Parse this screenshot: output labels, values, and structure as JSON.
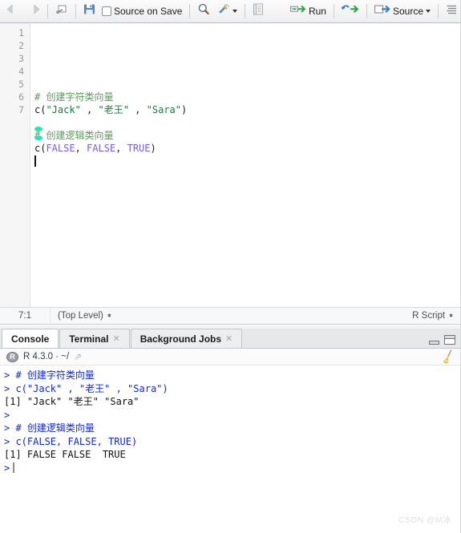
{
  "toolbar": {
    "back_icon": "arrow-left-icon",
    "forward_icon": "arrow-right-icon",
    "popout_icon": "show-in-new-window-icon",
    "save_icon": "save-icon",
    "source_on_save_label": "Source on Save",
    "find_icon": "magnifier-icon",
    "wand_icon": "magic-wand-icon",
    "compile_report_icon": "compile-report-icon",
    "run_label": "Run",
    "run_icon": "run-icon",
    "rerun_icon": "rerun-icon",
    "source_label": "Source",
    "source_icon": "source-icon",
    "outline_icon": "document-outline-icon"
  },
  "editor": {
    "line_numbers": [
      "1",
      "2",
      "3",
      "4",
      "5",
      "6",
      "7"
    ],
    "lines": [
      {
        "tokens": []
      },
      {
        "tokens": [
          {
            "t": "# 创建字符类向量",
            "k": "cmt"
          }
        ]
      },
      {
        "tokens": [
          {
            "t": "c(",
            "k": "pln"
          },
          {
            "t": "\"Jack\"",
            "k": "str"
          },
          {
            "t": " , ",
            "k": "pln"
          },
          {
            "t": "\"老王\"",
            "k": "str"
          },
          {
            "t": " , ",
            "k": "pln"
          },
          {
            "t": "\"Sara\"",
            "k": "str"
          },
          {
            "t": ")",
            "k": "pln"
          }
        ]
      },
      {
        "tokens": []
      },
      {
        "tokens": [
          {
            "t": "# 创建逻辑类向量",
            "k": "cmt"
          }
        ]
      },
      {
        "tokens": [
          {
            "t": "c(",
            "k": "pln"
          },
          {
            "t": "FALSE",
            "k": "kw"
          },
          {
            "t": ", ",
            "k": "pln"
          },
          {
            "t": "FALSE",
            "k": "kw"
          },
          {
            "t": ", ",
            "k": "pln"
          },
          {
            "t": "TRUE",
            "k": "kw"
          },
          {
            "t": ")",
            "k": "pln"
          }
        ]
      },
      {
        "tokens": []
      }
    ]
  },
  "status": {
    "cursor_position": "7:1",
    "scope": "(Top Level)",
    "file_type": "R Script"
  },
  "console_tabs": [
    {
      "label": "Console",
      "closable": false,
      "active": true
    },
    {
      "label": "Terminal",
      "closable": true,
      "active": false
    },
    {
      "label": "Background Jobs",
      "closable": true,
      "active": false
    }
  ],
  "console_tab_controls": {
    "minimize_icon": "minimize-icon",
    "maximize_icon": "maximize-icon"
  },
  "console_header": {
    "r_logo": "R",
    "version_path": "R 4.3.0  ·  ~/",
    "open_dir_icon": "open-directory-icon",
    "clear_icon": "broom-clear-console-icon"
  },
  "console_output": [
    {
      "segments": [
        {
          "t": "> # 创建字符类向量",
          "k": "in"
        }
      ]
    },
    {
      "segments": [
        {
          "t": "> c(\"Jack\" , \"老王\" , \"Sara\")",
          "k": "in"
        }
      ]
    },
    {
      "segments": [
        {
          "t": "[1] \"Jack\" \"老王\" \"Sara\"",
          "k": "out"
        }
      ]
    },
    {
      "segments": [
        {
          "t": ">",
          "k": "in"
        }
      ]
    },
    {
      "segments": [
        {
          "t": "> # 创建逻辑类向量",
          "k": "in"
        }
      ]
    },
    {
      "segments": [
        {
          "t": "> c(FALSE, FALSE, TRUE)",
          "k": "in"
        }
      ]
    },
    {
      "segments": [
        {
          "t": "[1] FALSE FALSE  TRUE",
          "k": "out"
        }
      ]
    },
    {
      "segments": [
        {
          "t": ">",
          "k": "in"
        }
      ],
      "caret": true
    }
  ],
  "watermark": "CSDN @M冰",
  "colors": {
    "comment": "#5a9c5a",
    "string": "#1f7a3f",
    "keyword": "#7a5ce0",
    "console_input": "#1028d8",
    "console_output": "#111111",
    "accent_green": "#2aa84a",
    "accent_blue": "#3a7fc1"
  }
}
